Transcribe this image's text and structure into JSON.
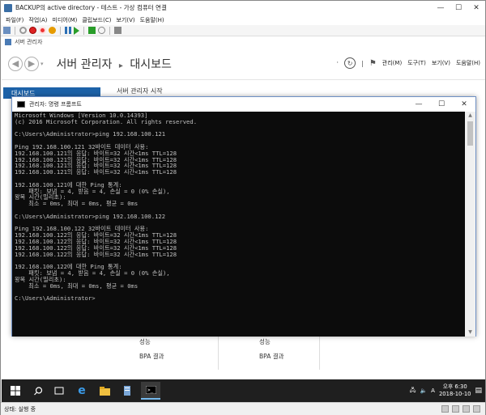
{
  "window": {
    "title": "BACKUP의 active directory - 테스트 - 가상 컴퓨터 연결",
    "controls": [
      "—",
      "☐",
      "✕"
    ]
  },
  "menu": [
    "파일(F)",
    "작업(A)",
    "미디어(M)",
    "클립보드(C)",
    "보기(V)",
    "도움말(H)"
  ],
  "server_manager": {
    "window_title": "서버 관리자",
    "breadcrumb_app": "서버 관리자",
    "breadcrumb_arrow": "▸",
    "breadcrumb_page": "대시보드",
    "menu_items": [
      "관리(M)",
      "도구(T)",
      "보기(V)",
      "도움말(H)"
    ],
    "nav_dashboard": "대시보드",
    "start_heading": "서버 관리자 시작",
    "tiles": [
      {
        "perf": "성능",
        "bpa": "BPA 결과"
      },
      {
        "perf": "성능",
        "bpa": "BPA 결과"
      }
    ]
  },
  "cmd": {
    "title": "관리자: 명령 프롬프트",
    "lines": [
      "Microsoft Windows [Version 10.0.14393]",
      "(c) 2016 Microsoft Corporation. All rights reserved.",
      "",
      "C:\\Users\\Administrator>ping 192.168.100.121",
      "",
      "Ping 192.168.100.121 32바이트 데이터 사용:",
      "192.168.100.121의 응답: 바이트=32 시간<1ms TTL=128",
      "192.168.100.121의 응답: 바이트=32 시간<1ms TTL=128",
      "192.168.100.121의 응답: 바이트=32 시간<1ms TTL=128",
      "192.168.100.121의 응답: 바이트=32 시간<1ms TTL=128",
      "",
      "192.168.100.121에 대한 Ping 통계:",
      "    패킷: 보냄 = 4, 받음 = 4, 손실 = 0 (0% 손실),",
      "왕복 시간(밀리초):",
      "    최소 = 0ms, 최대 = 0ms, 평균 = 0ms",
      "",
      "C:\\Users\\Administrator>ping 192.168.100.122",
      "",
      "Ping 192.168.100.122 32바이트 데이터 사용:",
      "192.168.100.122의 응답: 바이트=32 시간<1ms TTL=128",
      "192.168.100.122의 응답: 바이트=32 시간<1ms TTL=128",
      "192.168.100.122의 응답: 바이트=32 시간<1ms TTL=128",
      "192.168.100.122의 응답: 바이트=32 시간<1ms TTL=128",
      "",
      "192.168.100.122에 대한 Ping 통계:",
      "    패킷: 보냄 = 4, 받음 = 4, 손실 = 0 (0% 손실),",
      "왕복 시간(밀리초):",
      "    최소 = 0ms, 최대 = 0ms, 평균 = 0ms",
      "",
      "C:\\Users\\Administrator>"
    ]
  },
  "taskbar": {
    "time": "오후 6:30",
    "date": "2018-10-10",
    "ime": "A"
  },
  "status": {
    "text": "상태: 실행 중"
  },
  "colors": {
    "accent": "#1d62a8",
    "console_bg": "#0c0c0c",
    "console_text": "#c0c0c0",
    "taskbar": "#1f1f1f"
  }
}
